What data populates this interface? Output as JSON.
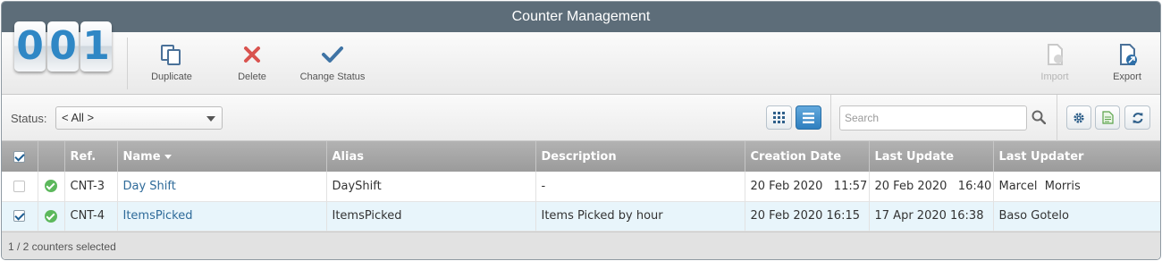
{
  "window": {
    "title": "Counter Management"
  },
  "logo": {
    "digits": [
      "0",
      "0",
      "1"
    ]
  },
  "toolbar": {
    "duplicate": "Duplicate",
    "delete": "Delete",
    "change_status": "Change Status",
    "import": "Import",
    "export": "Export"
  },
  "filter": {
    "status_label": "Status:",
    "status_value": "< All >",
    "search_placeholder": "Search"
  },
  "table": {
    "columns": [
      "Ref.",
      "Name",
      "Alias",
      "Description",
      "Creation Date",
      "Last Update",
      "Last Updater"
    ],
    "rows": [
      {
        "selected": false,
        "ref": "CNT-3",
        "name": "Day Shift",
        "alias": "DayShift",
        "description": "-",
        "creation_date": "20 Feb 2020   11:57",
        "last_update": "20 Feb 2020   16:40",
        "last_updater": "Marcel  Morris"
      },
      {
        "selected": true,
        "ref": "CNT-4",
        "name": "ItemsPicked",
        "alias": "ItemsPicked",
        "description": "Items Picked by hour",
        "creation_date": "20 Feb 2020 16:15",
        "last_update": "17 Apr 2020 16:38",
        "last_updater": "Baso Gotelo"
      }
    ]
  },
  "footer": {
    "selection_text": "1 / 2 counters selected"
  },
  "colors": {
    "titlebar": "#5d6d79",
    "accent": "#2e7fbf",
    "delete_red": "#d9534f",
    "ok_green": "#5cb85c"
  }
}
